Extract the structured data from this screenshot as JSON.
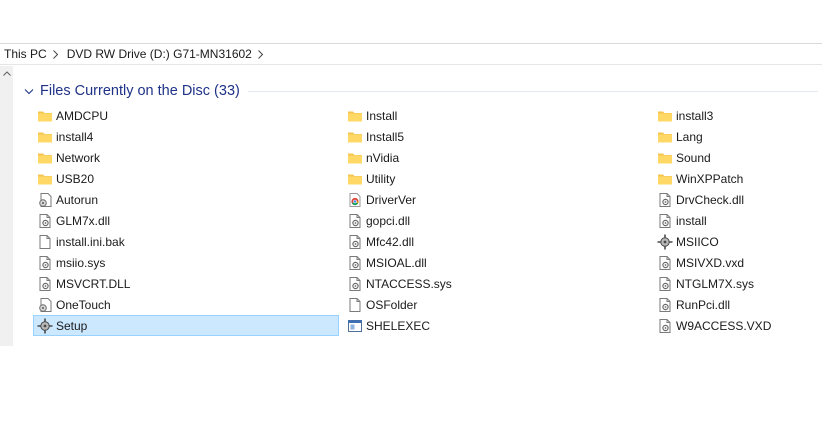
{
  "breadcrumb": [
    {
      "label": "This PC"
    },
    {
      "label": "DVD RW Drive (D:) G71-MN31602"
    }
  ],
  "group": {
    "title": "Files Currently on the Disc (33)"
  },
  "columns": [
    [
      {
        "label": "AMDCPU",
        "icon": "folder-icon"
      },
      {
        "label": "install4",
        "icon": "folder-icon"
      },
      {
        "label": "Network",
        "icon": "folder-icon"
      },
      {
        "label": "USB20",
        "icon": "folder-icon"
      },
      {
        "label": "Autorun",
        "icon": "settings-file-icon"
      },
      {
        "label": "GLM7x.dll",
        "icon": "dll-file-icon"
      },
      {
        "label": "install.ini.bak",
        "icon": "blank-file-icon"
      },
      {
        "label": "msiio.sys",
        "icon": "dll-file-icon"
      },
      {
        "label": "MSVCRT.DLL",
        "icon": "dll-file-icon"
      },
      {
        "label": "OneTouch",
        "icon": "settings-file-icon"
      },
      {
        "label": "Setup",
        "icon": "setup-app-icon",
        "selected": true
      }
    ],
    [
      {
        "label": "Install",
        "icon": "folder-icon"
      },
      {
        "label": "Install5",
        "icon": "folder-icon"
      },
      {
        "label": "nVidia",
        "icon": "folder-icon"
      },
      {
        "label": "Utility",
        "icon": "folder-icon"
      },
      {
        "label": "DriverVer",
        "icon": "chrome-html-icon"
      },
      {
        "label": "gopci.dll",
        "icon": "dll-file-icon"
      },
      {
        "label": "Mfc42.dll",
        "icon": "dll-file-icon"
      },
      {
        "label": "MSIOAL.dll",
        "icon": "dll-file-icon"
      },
      {
        "label": "NTACCESS.sys",
        "icon": "dll-file-icon"
      },
      {
        "label": "OSFolder",
        "icon": "blank-file-icon"
      },
      {
        "label": "SHELEXEC",
        "icon": "window-app-icon"
      }
    ],
    [
      {
        "label": "install3",
        "icon": "folder-icon"
      },
      {
        "label": "Lang",
        "icon": "folder-icon"
      },
      {
        "label": "Sound",
        "icon": "folder-icon"
      },
      {
        "label": "WinXPPatch",
        "icon": "folder-icon"
      },
      {
        "label": "DrvCheck.dll",
        "icon": "dll-file-icon"
      },
      {
        "label": "install",
        "icon": "dll-file-icon"
      },
      {
        "label": "MSIICO",
        "icon": "setup-app-icon"
      },
      {
        "label": "MSIVXD.vxd",
        "icon": "dll-file-icon"
      },
      {
        "label": "NTGLM7X.sys",
        "icon": "dll-file-icon"
      },
      {
        "label": "RunPci.dll",
        "icon": "dll-file-icon"
      },
      {
        "label": "W9ACCESS.VXD",
        "icon": "dll-file-icon"
      }
    ]
  ],
  "colors": {
    "group_title": "#1e3287",
    "selection_bg": "#cce8ff",
    "selection_border": "#99d1ff",
    "folder": "#ffd866"
  }
}
